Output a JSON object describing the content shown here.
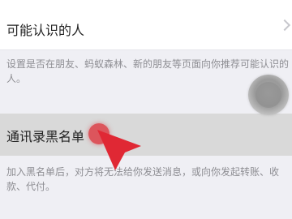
{
  "settings": {
    "people_you_may_know": {
      "label": "可能认识的人",
      "description": "设置是否在朋友、蚂蚁森林、新的朋友等页面向你推荐可能认识的人。"
    },
    "blacklist": {
      "label": "通讯录黑名单",
      "description": "加入黑名单后，对方将无法给你发送消息，或向你发起转账、收款、代付。"
    }
  },
  "icons": {
    "chevron": "chevron-right-icon",
    "pointer": "red-pointer-arrow-icon",
    "assistive_touch": "assistive-touch-icon"
  },
  "colors": {
    "background": "#efeff4",
    "row": "#ffffff",
    "pressed_row": "#d9d9d9",
    "label": "#222222",
    "description": "#8e8e93",
    "annotation_red": "#e02834"
  }
}
